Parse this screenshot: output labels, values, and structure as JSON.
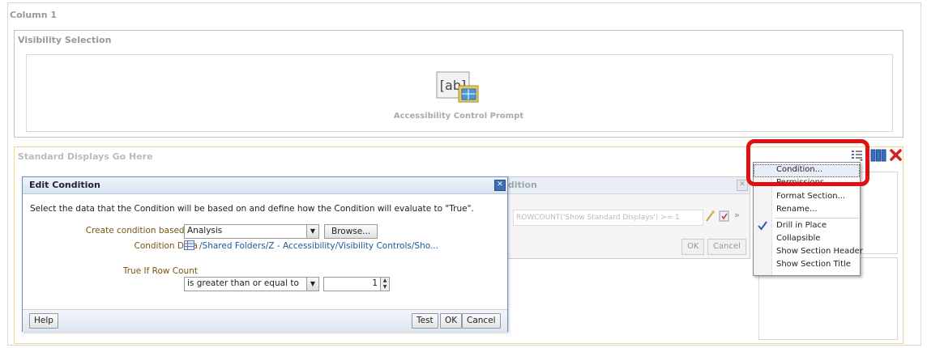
{
  "column": {
    "title": "Column 1"
  },
  "visibility_section": {
    "title": "Visibility Selection",
    "prompt_icon_text": "[ab]",
    "prompt_label": "Accessibility Control Prompt"
  },
  "standard_section": {
    "title": "Standard Displays Go Here"
  },
  "background_dialog": {
    "title": "ndition",
    "expression": "ROWCOUNT('Show Standard Displays') >= 1",
    "ok_label": "OK",
    "cancel_label": "Cancel"
  },
  "edit_condition": {
    "title": "Edit Condition",
    "description": "Select the data that the Condition will be based on and define how the Condition will evaluate to \"True\".",
    "based_on_label": "Create condition based on",
    "based_on_value": "Analysis",
    "browse_label": "Browse...",
    "condition_data_label": "Condition Data",
    "condition_data_path": "/Shared Folders/Z - Accessibility/Visibility Controls/Sho...",
    "true_if_label": "True If Row Count",
    "operator_value": "is greater than or equal to",
    "count_value": "1",
    "help_label": "Help",
    "test_label": "Test",
    "ok_label": "OK",
    "cancel_label": "Cancel"
  },
  "context_menu": {
    "items": [
      {
        "label": "Condition...",
        "highlighted": true
      },
      {
        "label": "Permissions..."
      },
      {
        "label": "Format Section..."
      },
      {
        "label": "Rename..."
      },
      {
        "label": "Drill in Place",
        "checked": true
      },
      {
        "label": "Collapsible"
      },
      {
        "label": "Show Section Header"
      },
      {
        "label": "Show Section Title"
      }
    ]
  },
  "colors": {
    "accent_red": "#e01010",
    "label_brown": "#7a5412",
    "link_blue": "#1a5a9a",
    "dialog_border": "#6f8fb8"
  }
}
